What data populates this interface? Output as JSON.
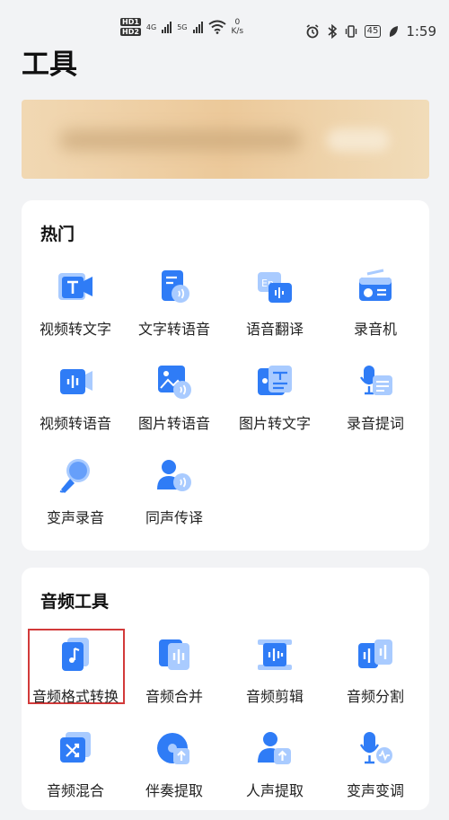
{
  "status_bar": {
    "hd1": "HD1",
    "hd2": "HD2",
    "net1": "4G",
    "net2": "5G",
    "speed_value": "0",
    "speed_unit": "K/s",
    "battery": "45",
    "time": "1:59"
  },
  "page": {
    "title": "工具"
  },
  "hot": {
    "title": "热门",
    "items": [
      {
        "label": "视频转文字",
        "icon": "video-to-text-icon"
      },
      {
        "label": "文字转语音",
        "icon": "text-to-speech-icon"
      },
      {
        "label": "语音翻译",
        "icon": "voice-translate-icon"
      },
      {
        "label": "录音机",
        "icon": "recorder-icon"
      },
      {
        "label": "视频转语音",
        "icon": "video-to-speech-icon"
      },
      {
        "label": "图片转语音",
        "icon": "image-to-speech-icon"
      },
      {
        "label": "图片转文字",
        "icon": "image-to-text-icon"
      },
      {
        "label": "录音提词",
        "icon": "teleprompter-icon"
      },
      {
        "label": "变声录音",
        "icon": "voice-change-record-icon"
      },
      {
        "label": "同声传译",
        "icon": "simultaneous-interpretation-icon"
      }
    ]
  },
  "audio": {
    "title": "音频工具",
    "items": [
      {
        "label": "音频格式转换",
        "icon": "audio-format-convert-icon"
      },
      {
        "label": "音频合并",
        "icon": "audio-merge-icon"
      },
      {
        "label": "音频剪辑",
        "icon": "audio-cut-icon"
      },
      {
        "label": "音频分割",
        "icon": "audio-split-icon"
      },
      {
        "label": "音频混合",
        "icon": "audio-mix-icon"
      },
      {
        "label": "伴奏提取",
        "icon": "accompaniment-extract-icon"
      },
      {
        "label": "人声提取",
        "icon": "vocal-extract-icon"
      },
      {
        "label": "变声变调",
        "icon": "voice-pitch-change-icon"
      }
    ]
  },
  "colors": {
    "accent": "#2f7cf6",
    "accent_light": "#a9cbff",
    "highlight": "#d23a3a"
  }
}
